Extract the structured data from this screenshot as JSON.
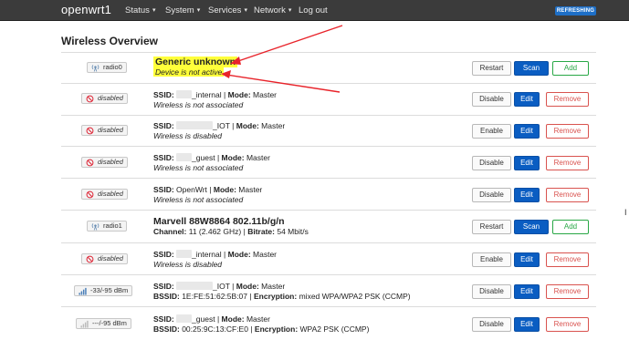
{
  "header": {
    "brand": "openwrt1",
    "menu": [
      "Status",
      "System",
      "Services",
      "Network",
      "Log out"
    ],
    "menu_caret": "▾",
    "refreshing_label": "REFRESHING"
  },
  "page": {
    "title": "Wireless Overview"
  },
  "labels": {
    "ssid": "SSID:",
    "mode": "Mode:",
    "bssid": "BSSID:",
    "encryption": "Encryption:",
    "channel": "Channel:",
    "bitrate": "Bitrate:",
    "separator": "|"
  },
  "buttons": {
    "restart": "Restart",
    "scan": "Scan",
    "add": "Add",
    "disable": "Disable",
    "enable": "Enable",
    "edit": "Edit",
    "remove": "Remove"
  },
  "radios": [
    {
      "badge": "radio0",
      "device": "Generic unknown",
      "status": "Device is not active",
      "highlighted": true
    },
    {
      "badge": "radio1",
      "device": "Marvell 88W8864 802.11b/g/n",
      "channel": "11 (2.462 GHz)",
      "bitrate": "54 Mbit/s"
    }
  ],
  "networks": [
    {
      "badge": "disabled",
      "ssid_suffix": "_internal",
      "mode": "Master",
      "status": "Wireless is not associated",
      "toggle": "Disable"
    },
    {
      "badge": "disabled",
      "ssid_suffix": "_IOT",
      "mode": "Master",
      "status": "Wireless is disabled",
      "toggle": "Enable"
    },
    {
      "badge": "disabled",
      "ssid_suffix": "_guest",
      "mode": "Master",
      "status": "Wireless is not associated",
      "toggle": "Disable"
    },
    {
      "badge": "disabled",
      "ssid": "OpenWrt",
      "mode": "Master",
      "status": "Wireless is not associated",
      "toggle": "Disable"
    },
    {
      "badge": "disabled",
      "ssid_suffix": "_internal",
      "mode": "Master",
      "status": "Wireless is disabled",
      "toggle": "Enable"
    },
    {
      "badge": "-33/-95 dBm",
      "ssid_suffix": "_IOT",
      "mode": "Master",
      "bssid": "1E:FE:51:62:5B:07",
      "encryption": "mixed WPA/WPA2 PSK (CCMP)",
      "toggle": "Disable"
    },
    {
      "badge": "---/-95 dBm",
      "ssid_suffix": "_guest",
      "mode": "Master",
      "bssid": "00:25:9C:13:CF:E0",
      "encryption": "WPA2 PSK (CCMP)",
      "toggle": "Disable"
    }
  ],
  "colors": {
    "topbar": "#3b3b3b",
    "primary": "#0a5dc2",
    "add": "#28a745",
    "remove": "#d9534f",
    "highlight": "#ffff3a",
    "annotation_arrow": "#e8232a"
  },
  "icons": {
    "radio": "radio-tower-icon",
    "disabled": "disabled-signal-icon",
    "signal": "signal-bars-icon",
    "cursor": "text-cursor-icon"
  }
}
